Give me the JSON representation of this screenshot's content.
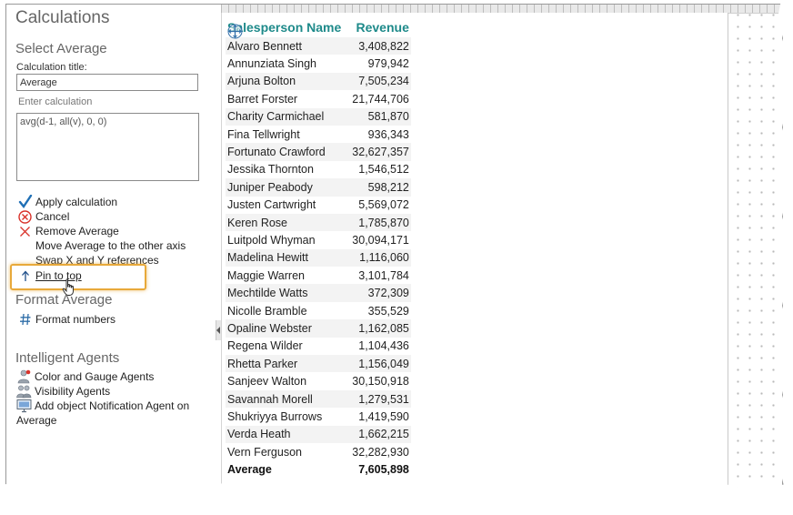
{
  "panel": {
    "title": "Calculations",
    "select_section": "Select Average",
    "calc_title_label": "Calculation title:",
    "calc_title_value": "Average",
    "enter_calc_label": "Enter calculation",
    "calc_value": "avg(d-1, all(v), 0, 0)",
    "actions": {
      "apply": "Apply calculation",
      "cancel": "Cancel",
      "remove": "Remove Average",
      "move": "Move Average to the other axis",
      "swap": "Swap X and Y references",
      "pin": "Pin to top"
    },
    "format_section": "Format Average",
    "format_numbers": "Format numbers",
    "agents_section": "Intelligent Agents",
    "agents": {
      "color_gauge": "Color and Gauge Agents",
      "visibility": "Visibility Agents",
      "notification": "Add object Notification Agent on Average"
    }
  },
  "table": {
    "headers": {
      "name": "Salesperson Name",
      "revenue": "Revenue"
    },
    "rows": [
      {
        "name": "Alvaro Bennett",
        "revenue": "3,408,822"
      },
      {
        "name": "Annunziata Singh",
        "revenue": "979,942"
      },
      {
        "name": "Arjuna Bolton",
        "revenue": "7,505,234"
      },
      {
        "name": "Barret Forster",
        "revenue": "21,744,706"
      },
      {
        "name": "Charity Carmichael",
        "revenue": "581,870"
      },
      {
        "name": "Fina Tellwright",
        "revenue": "936,343"
      },
      {
        "name": "Fortunato Crawford",
        "revenue": "32,627,357"
      },
      {
        "name": "Jessika Thornton",
        "revenue": "1,546,512"
      },
      {
        "name": "Juniper Peabody",
        "revenue": "598,212"
      },
      {
        "name": "Justen Cartwright",
        "revenue": "5,569,072"
      },
      {
        "name": "Keren Rose",
        "revenue": "1,785,870"
      },
      {
        "name": "Luitpold Whyman",
        "revenue": "30,094,171"
      },
      {
        "name": "Madelina Hewitt",
        "revenue": "1,116,060"
      },
      {
        "name": "Maggie Warren",
        "revenue": "3,101,784"
      },
      {
        "name": "Mechtilde Watts",
        "revenue": "372,309"
      },
      {
        "name": "Nicolle Bramble",
        "revenue": "355,529"
      },
      {
        "name": "Opaline Webster",
        "revenue": "1,162,085"
      },
      {
        "name": "Regena Wilder",
        "revenue": "1,104,436"
      },
      {
        "name": "Rhetta Parker",
        "revenue": "1,156,049"
      },
      {
        "name": "Sanjeev Walton",
        "revenue": "30,150,918"
      },
      {
        "name": "Savannah Morell",
        "revenue": "1,279,531"
      },
      {
        "name": "Shukriyya Burrows",
        "revenue": "1,419,590"
      },
      {
        "name": "Verda Heath",
        "revenue": "1,662,215"
      },
      {
        "name": "Vern Ferguson",
        "revenue": "32,282,930"
      }
    ],
    "average": {
      "name": "Average",
      "revenue": "7,605,898"
    }
  },
  "colors": {
    "header_teal": "#1e8a8a",
    "highlight_orange": "#e8a93a",
    "apply_check": "#1f6fb5",
    "cancel_red": "#d9322a"
  },
  "icons": {
    "apply": "checkmark-icon",
    "cancel": "cancel-circle-icon",
    "remove": "x-icon",
    "pin": "arrow-up-icon",
    "format": "hash-icon",
    "move_handle": "move-arrows-icon",
    "cursor": "hand-pointer-icon"
  }
}
